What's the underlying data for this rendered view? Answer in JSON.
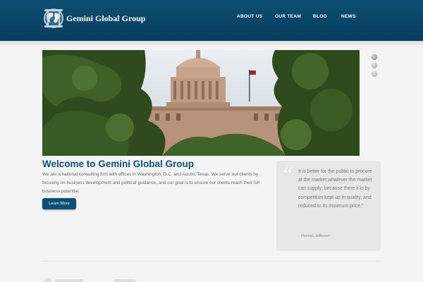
{
  "header": {
    "brand": "Gemini Global Group",
    "logo_icon": "globe-logo-icon",
    "nav": [
      {
        "label": "ABOUT US"
      },
      {
        "label": "OUR TEAM"
      },
      {
        "label": "BLOG"
      },
      {
        "label": "NEWS"
      }
    ]
  },
  "hero": {
    "image": "capitol-building-photo",
    "slides": 3,
    "active_slide": 1
  },
  "welcome": {
    "title": "Welcome to Gemini Global Group",
    "body": "We are a national consulting firm with offices in Washington, D.C. and Austin, Texas. We serve our clients by focusing on business development and political guidance, and our goal is to ensure our clients reach their full business potential.",
    "button": "Learn More"
  },
  "quote": {
    "text": "It is better for the public to procure at the market whatever the market can supply; because there it is by competition kept up in quality, and reduced to its minimum price.\"",
    "author": "- Thomas Jefferson"
  },
  "colors": {
    "header": "#0a4668",
    "accent": "#0d4f77",
    "background": "#f4f4f4"
  }
}
